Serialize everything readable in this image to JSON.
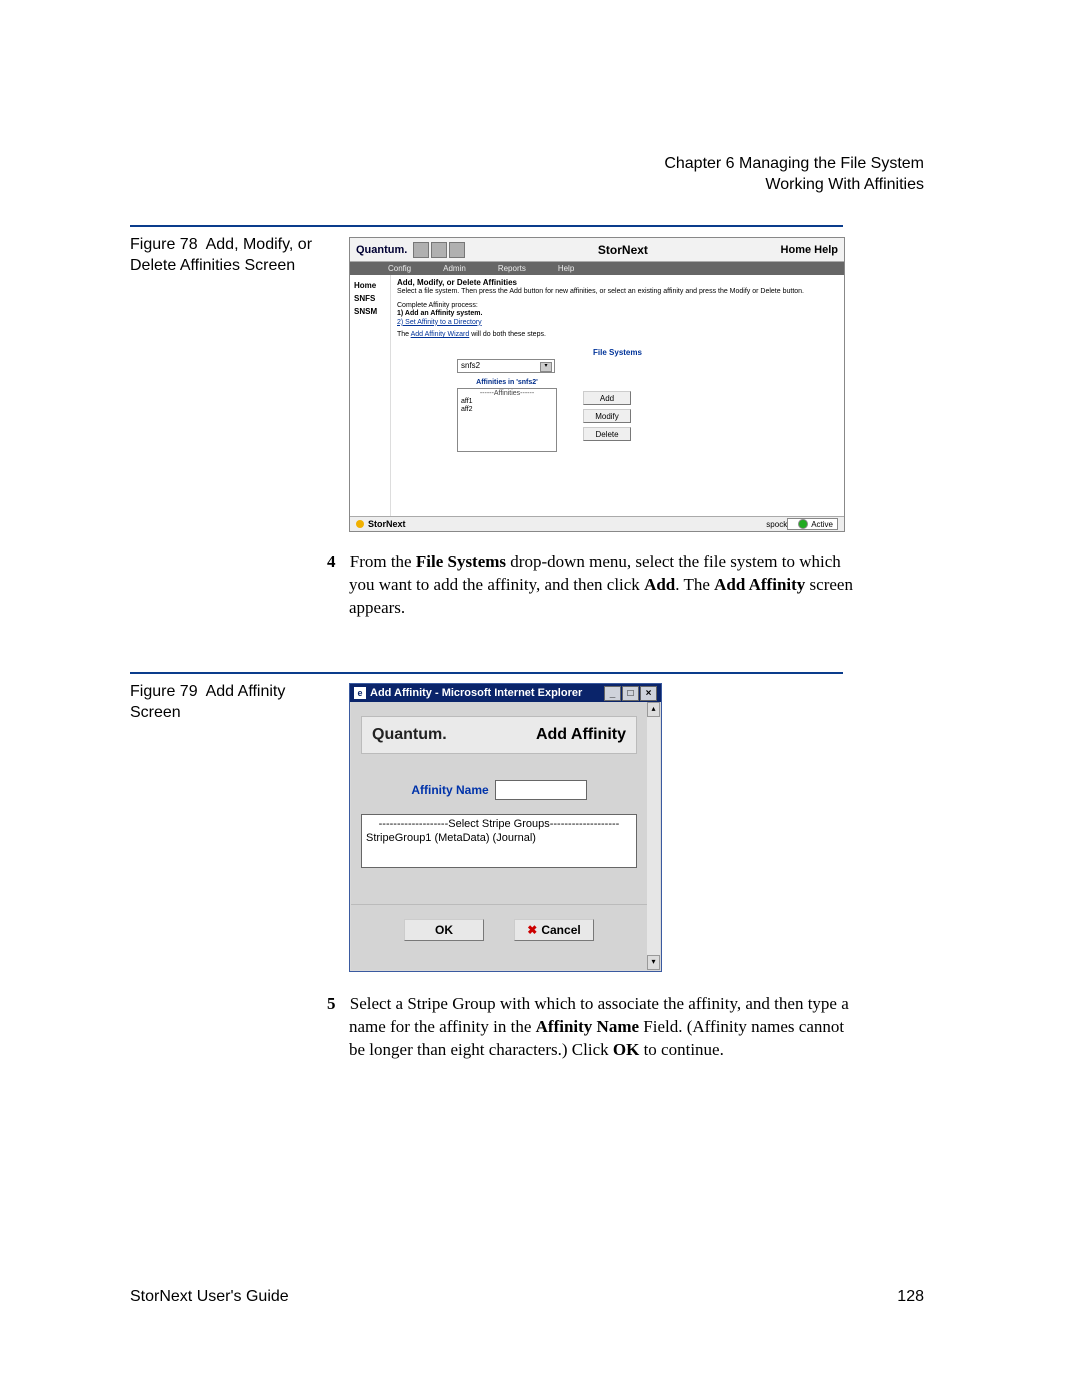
{
  "header": {
    "chapter": "Chapter 6  Managing the File System",
    "section": "Working With Affinities"
  },
  "figures": {
    "fig78": {
      "label": "Figure 78",
      "title": "Add, Modify, or Delete Affinities Screen"
    },
    "fig79": {
      "label": "Figure 79",
      "title": "Add Affinity Screen"
    }
  },
  "screenshot78": {
    "brand": "Quantum.",
    "app_title": "StorNext",
    "home_help": "Home  Help",
    "menu": {
      "config": "Config",
      "admin": "Admin",
      "reports": "Reports",
      "help": "Help"
    },
    "sidebar": {
      "home": "Home",
      "snfs": "SNFS",
      "snsm": "SNSM"
    },
    "heading": "Add, Modify, or Delete Affinities",
    "desc": "Select a file system. Then press the Add button for new affinities, or select an existing affinity and press the Modify or Delete button.",
    "proc_label": "Complete Affinity process:",
    "proc1": "1) Add an Affinity system.",
    "proc2": "2) Set Affinity to a Directory",
    "wizard1": "The ",
    "wizard_link": "Add Affinity Wizard",
    "wizard2": " will do both these steps.",
    "fs_label": "File Systems",
    "fs_value": "snfs2",
    "aff_label": "Affinities in 'snfs2'",
    "aff_header": "------Affinities------",
    "aff_items": {
      "a1": "aff1",
      "a2": "aff2"
    },
    "buttons": {
      "add": "Add",
      "modify": "Modify",
      "delete": "Delete"
    },
    "status": {
      "product": "StorNext",
      "host": "spock",
      "state": "Active"
    }
  },
  "step4": {
    "num": "4",
    "t1": "From the ",
    "b1": "File Systems",
    "t2": " drop-down menu, select the file system to which you want to add the affinity, and then click ",
    "b2": "Add",
    "t3": ". The ",
    "b3": "Add Affinity",
    "t4": " screen appears."
  },
  "screenshot79": {
    "window_title": "Add Affinity - Microsoft Internet Explorer",
    "brand": "Quantum.",
    "title": "Add Affinity",
    "field_label": "Affinity Name",
    "list_header": "-------------------Select Stripe Groups-------------------",
    "list_item": "StripeGroup1 (MetaData) (Journal)",
    "ok": "OK",
    "cancel": "Cancel"
  },
  "step5": {
    "num": "5",
    "t1": "Select a Stripe Group with which to associate the affinity, and then type a name for the affinity in the ",
    "b1": "Affinity Name",
    "t2": " Field. (Affinity names cannot be longer than eight characters.) Click ",
    "b2": "OK",
    "t3": " to continue."
  },
  "footer": {
    "left": "StorNext User's Guide",
    "right": "128"
  }
}
